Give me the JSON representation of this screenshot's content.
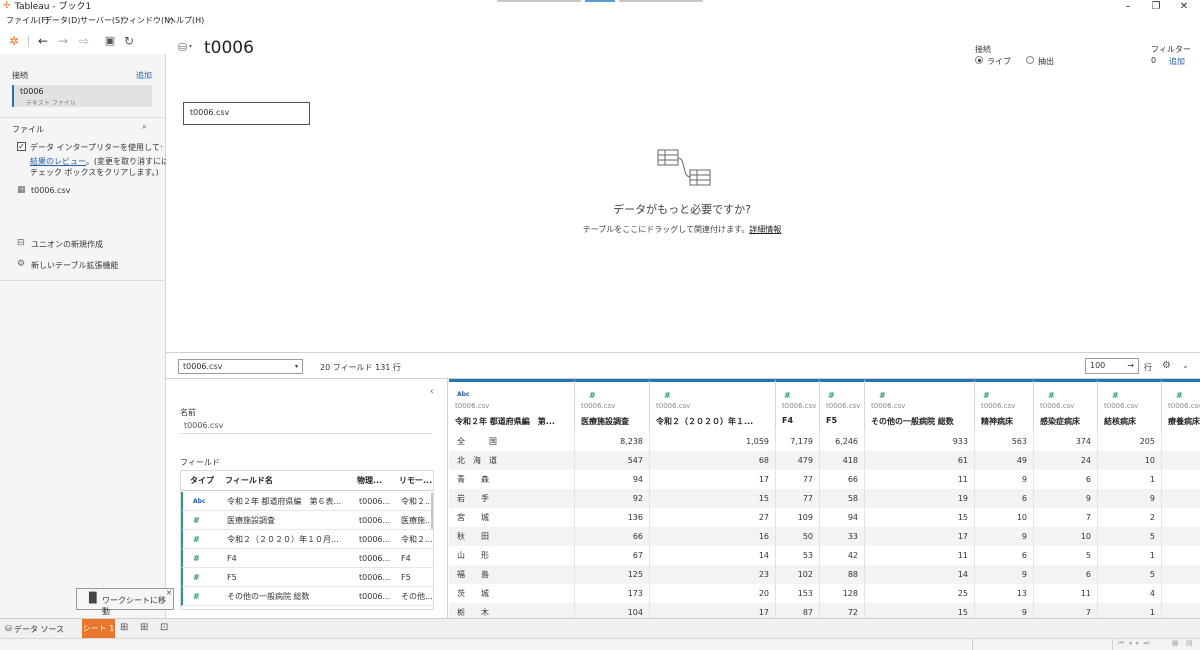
{
  "window": {
    "title": "Tableau - ブック1"
  },
  "menu": [
    "ファイル(F)",
    "データ(D)",
    "サーバー(S)",
    "ウィンドウ(N)",
    "ヘルプ(H)"
  ],
  "colors": {
    "accent": "#e8762d",
    "link": "#1f5fa8",
    "selection": "#1f77b4",
    "number_icon": "#2a9a84"
  },
  "left_panel": {
    "connections_label": "接続",
    "add_label": "追加",
    "connection": {
      "name": "t0006",
      "type": "テキスト ファイル"
    },
    "files_label": "ファイル",
    "interpreter_text": "データ インタープリターを使用してクリーニング",
    "review_link": "結果のレビュー",
    "review_text": "。(変更を取り消すにはチェック ボックスをクリアします。)",
    "review_text_line2": "チェック ボックスをクリアします。)",
    "file_item": "t0006.csv",
    "new_union": "ユニオンの新規作成",
    "new_table_ext": "新しいテーブル拡張機能"
  },
  "canvas": {
    "title": "t0006",
    "table_box": "t0006.csv",
    "connection_label": "接続",
    "live_label": "ライブ",
    "extract_label": "抽出",
    "filter_label": "フィルター",
    "filter_count": "0",
    "filter_add": "追加",
    "need_more_title": "データがもっと必要ですか?",
    "need_more_text": "テーブルをここにドラッグして関連付けます。",
    "details_link": "詳細情報"
  },
  "data_bar": {
    "table_select": "t0006.csv",
    "summary": "20 フィールド 131 行",
    "row_count": "100",
    "rows_label": "行"
  },
  "meta": {
    "name_label": "名前",
    "name_value": "t0006.csv",
    "fields_label": "フィールド",
    "headers": [
      "タイプ",
      "フィールド名",
      "物理...",
      "リモー..."
    ],
    "rows": [
      {
        "type": "Abc",
        "name": "令和２年 都道府県編　第６表...",
        "physical": "t0006...",
        "remote": "令和２..."
      },
      {
        "type": "#",
        "name": "医療施設調査",
        "physical": "t0006...",
        "remote": "医療施..."
      },
      {
        "type": "#",
        "name": "令和２（２０２０）年１０月...",
        "physical": "t0006...",
        "remote": "令和２..."
      },
      {
        "type": "#",
        "name": "F4",
        "physical": "t0006...",
        "remote": "F4"
      },
      {
        "type": "#",
        "name": "F5",
        "physical": "t0006...",
        "remote": "F5"
      },
      {
        "type": "#",
        "name": "その他の一般病院 総数",
        "physical": "t0006...",
        "remote": "その他..."
      }
    ]
  },
  "grid": {
    "columns": [
      {
        "icon": "Abc",
        "source": "t0006.csv",
        "name": "令和２年 都道府県編　第..."
      },
      {
        "icon": "#",
        "source": "t0006.csv",
        "name": "医療施設調査"
      },
      {
        "icon": "#",
        "source": "t0006.csv",
        "name": "令和２（２０２０）年１..."
      },
      {
        "icon": "#",
        "source": "t0006.csv",
        "name": "F4"
      },
      {
        "icon": "#",
        "source": "t0006.csv",
        "name": "F5"
      },
      {
        "icon": "#",
        "source": "t0006.csv",
        "name": "その他の一般病院 総数"
      },
      {
        "icon": "#",
        "source": "t0006.csv",
        "name": "精神病床"
      },
      {
        "icon": "#",
        "source": "t0006.csv",
        "name": "感染症病床"
      },
      {
        "icon": "#",
        "source": "t0006.csv",
        "name": "結核病床"
      },
      {
        "icon": "#",
        "source": "t0006.csv",
        "name": "療養病床"
      }
    ],
    "rows": [
      [
        "全　　　国",
        "8,238",
        "1,059",
        "7,179",
        "6,246",
        "933",
        "563",
        "374",
        "205",
        ""
      ],
      [
        "北　海　道",
        "547",
        "68",
        "479",
        "418",
        "61",
        "49",
        "24",
        "10",
        ""
      ],
      [
        "青　　森",
        "94",
        "17",
        "77",
        "66",
        "11",
        "9",
        "6",
        "1",
        ""
      ],
      [
        "岩　　手",
        "92",
        "15",
        "77",
        "58",
        "19",
        "6",
        "9",
        "9",
        ""
      ],
      [
        "宮　　城",
        "136",
        "27",
        "109",
        "94",
        "15",
        "10",
        "7",
        "2",
        ""
      ],
      [
        "秋　　田",
        "66",
        "16",
        "50",
        "33",
        "17",
        "9",
        "10",
        "5",
        ""
      ],
      [
        "山　　形",
        "67",
        "14",
        "53",
        "42",
        "11",
        "6",
        "5",
        "1",
        ""
      ],
      [
        "福　　島",
        "125",
        "23",
        "102",
        "88",
        "14",
        "9",
        "6",
        "5",
        ""
      ],
      [
        "茨　　城",
        "173",
        "20",
        "153",
        "128",
        "25",
        "13",
        "11",
        "4",
        ""
      ],
      [
        "栃　　木",
        "104",
        "17",
        "87",
        "72",
        "15",
        "9",
        "7",
        "1",
        ""
      ]
    ]
  },
  "bottom": {
    "datasource_tab": "データ ソース",
    "sheet_tab": "シート 1",
    "tooltip_text": "ワークシートに移動"
  }
}
